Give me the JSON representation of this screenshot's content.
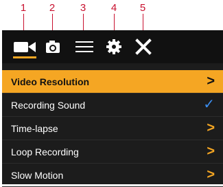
{
  "callouts": [
    "1",
    "2",
    "3",
    "4",
    "5"
  ],
  "toolbar": {
    "icons": [
      "video-camera-icon",
      "photo-camera-icon",
      "menu-lines-icon",
      "gear-icon",
      "close-icon"
    ],
    "active": "video-camera-icon"
  },
  "menu": {
    "items": [
      {
        "label": "Video Resolution",
        "indicator": ">",
        "selected": true
      },
      {
        "label": "Recording Sound",
        "indicator": "✓",
        "selected": false
      },
      {
        "label": "Time-lapse",
        "indicator": ">",
        "selected": false
      },
      {
        "label": "Loop Recording",
        "indicator": ">",
        "selected": false
      },
      {
        "label": "Slow Motion",
        "indicator": ">",
        "selected": false
      }
    ]
  },
  "colors": {
    "accent": "#f5a623",
    "callout": "#c8102e",
    "check": "#3b8ef0",
    "screen_bg": "#1c1c1c"
  }
}
